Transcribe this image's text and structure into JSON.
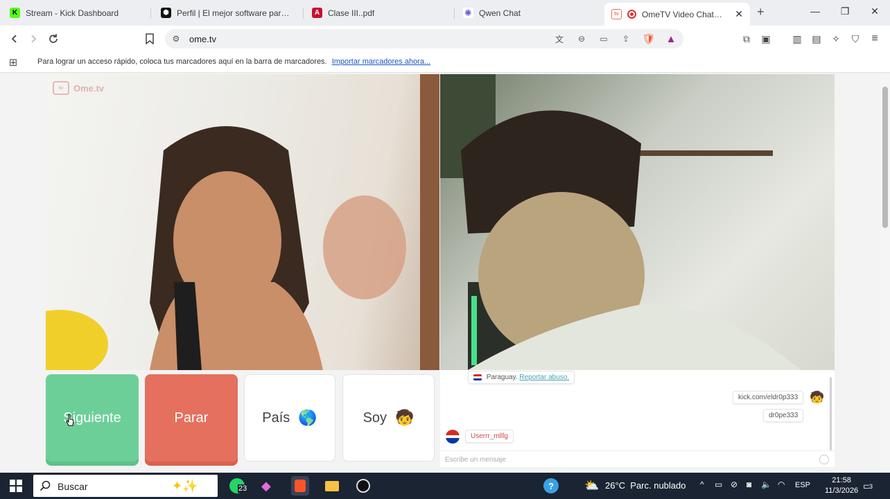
{
  "tabs": [
    {
      "title": "Stream - Kick Dashboard",
      "icon": "kick-icon",
      "color": "#53fc18"
    },
    {
      "title": "Perfil | El mejor software para pote",
      "icon": "perfil-icon",
      "color": "#111111"
    },
    {
      "title": "Clase III..pdf",
      "icon": "pdf-icon",
      "color": "#c8102e"
    },
    {
      "title": "Qwen Chat",
      "icon": "qwen-icon",
      "color": "#6f5bd8"
    },
    {
      "title": "OmeTV Video Chat — Om",
      "icon": "ometv-icon",
      "color": "#e5705e",
      "active": true
    }
  ],
  "address_bar": {
    "url": "ome.tv"
  },
  "bookmarks_bar": {
    "message": "Para lograr un acceso rápido, coloca tus marcadores aquí en la barra de marcadores.",
    "link": "Importar marcadores ahora..."
  },
  "site": {
    "logo_text": "Ome.tv"
  },
  "buttons": {
    "next": "Siguiente",
    "stop": "Parar",
    "country": "País",
    "country_emoji": "🌎",
    "gender": "Soy",
    "gender_emoji": "🧒"
  },
  "chat": {
    "country_notice": "Paraguay.",
    "report_link": "Reportar abuso.",
    "outgoing": [
      "kick.com/eldr0p333",
      "dr0pe333"
    ],
    "incoming": [
      "Userrr_mlllg"
    ],
    "input_placeholder": "Escribe un mensaje"
  },
  "taskbar": {
    "search_label": "Buscar",
    "whatsapp_badge": "23",
    "weather": "26°C  Parc. nublado",
    "language": "ESP",
    "time": "21:58",
    "date": "11/3/2026",
    "notification_count": "3"
  }
}
